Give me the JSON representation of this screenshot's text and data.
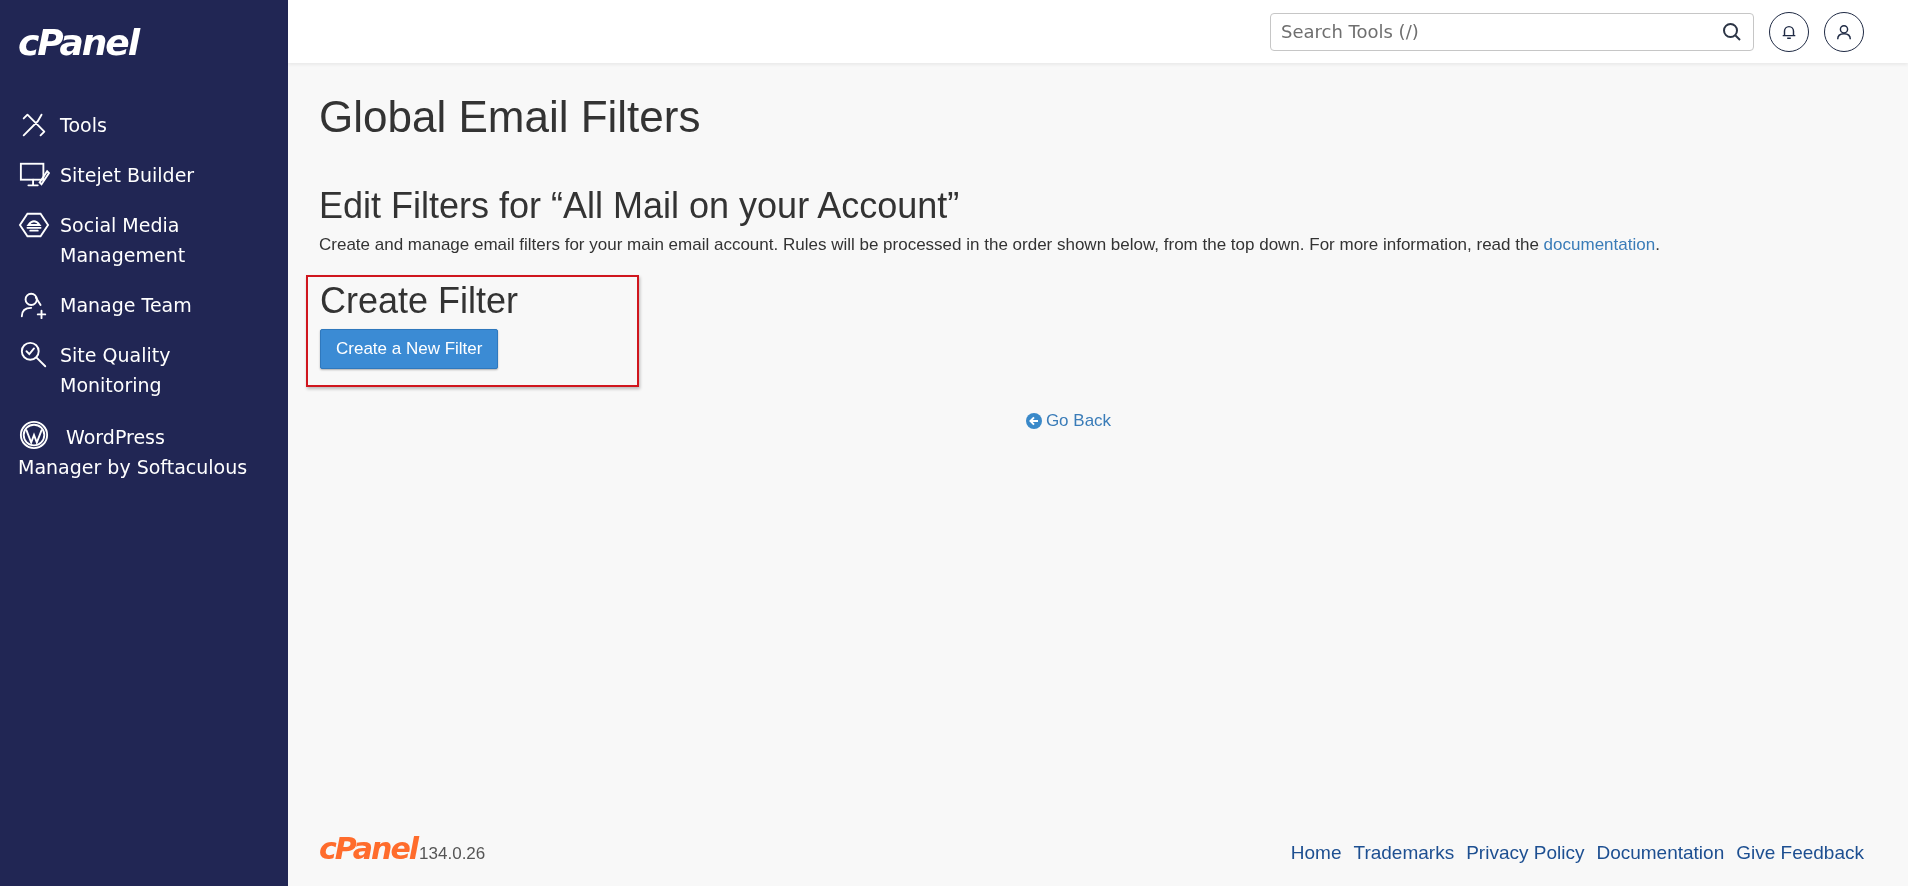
{
  "sidebar": {
    "logo": "cPanel",
    "items": [
      {
        "label": "Tools",
        "kind": "flex"
      },
      {
        "label": "Sitejet Builder",
        "kind": "flex"
      },
      {
        "label": "Social Media Management",
        "kind": "flex"
      },
      {
        "label": "Manage Team",
        "kind": "flex"
      },
      {
        "label": "Site Quality Monitoring",
        "kind": "flex"
      },
      {
        "label": "WordPress Manager by Softaculous",
        "kind": "inline"
      }
    ]
  },
  "topbar": {
    "search": {
      "placeholder": "Search Tools (/)"
    }
  },
  "page": {
    "title": "Global Email Filters",
    "subtitle": "Edit Filters for “All Mail on your Account”",
    "description": "Create and manage email filters for your main email account. Rules will be processed in the order shown below, from the top down. For more information, read the ",
    "description_link": "documentation",
    "description_end": ".",
    "section_title": "Create Filter",
    "create_button": "Create a New Filter",
    "back_link": "Go Back"
  },
  "footer": {
    "logo": "cPanel",
    "version": "134.0.26",
    "links": [
      "Home",
      "Trademarks",
      "Privacy Policy",
      "Documentation",
      "Give Feedback"
    ]
  }
}
